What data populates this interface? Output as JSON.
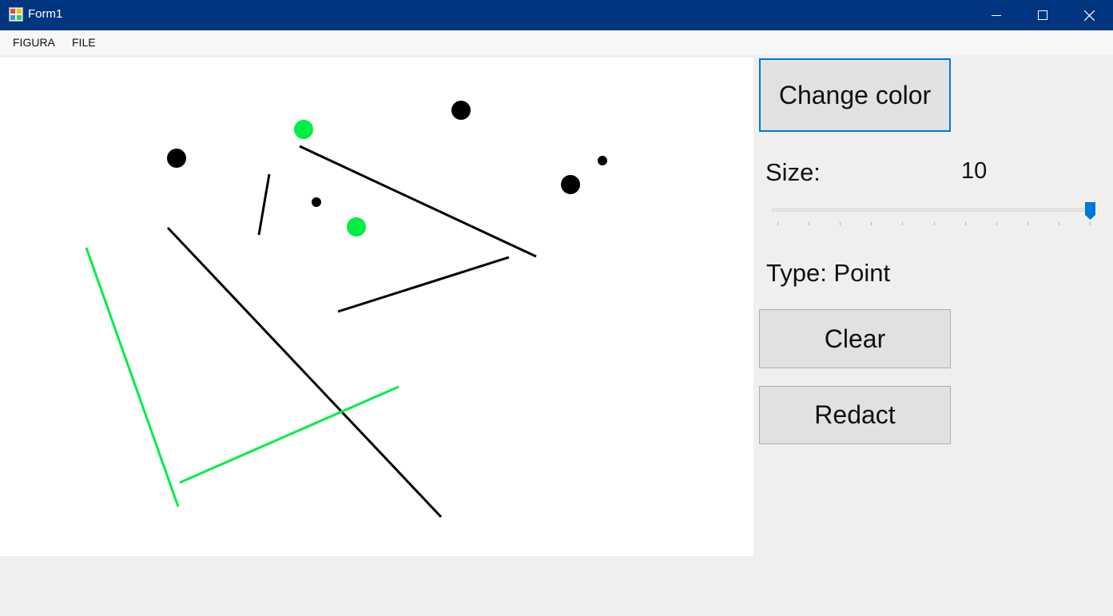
{
  "window": {
    "title": "Form1",
    "title_bar_color": "#003580",
    "controls": {
      "minimize_icon": "minimize-icon",
      "maximize_icon": "maximize-icon",
      "close_icon": "close-icon"
    }
  },
  "menu": {
    "items": [
      {
        "label": "FIGURA"
      },
      {
        "label": "FILE"
      }
    ]
  },
  "panel": {
    "change_color_label": "Change color",
    "size_label": "Size:",
    "size_value": "10",
    "slider": {
      "value": 10,
      "min": 0,
      "max": 10,
      "accent": "#0078d7"
    },
    "type_label": "Type: Point",
    "clear_label": "Clear",
    "redact_label": "Redact"
  },
  "canvas": {
    "colors": {
      "black": "#000000",
      "green": "#00ee44"
    }
  }
}
